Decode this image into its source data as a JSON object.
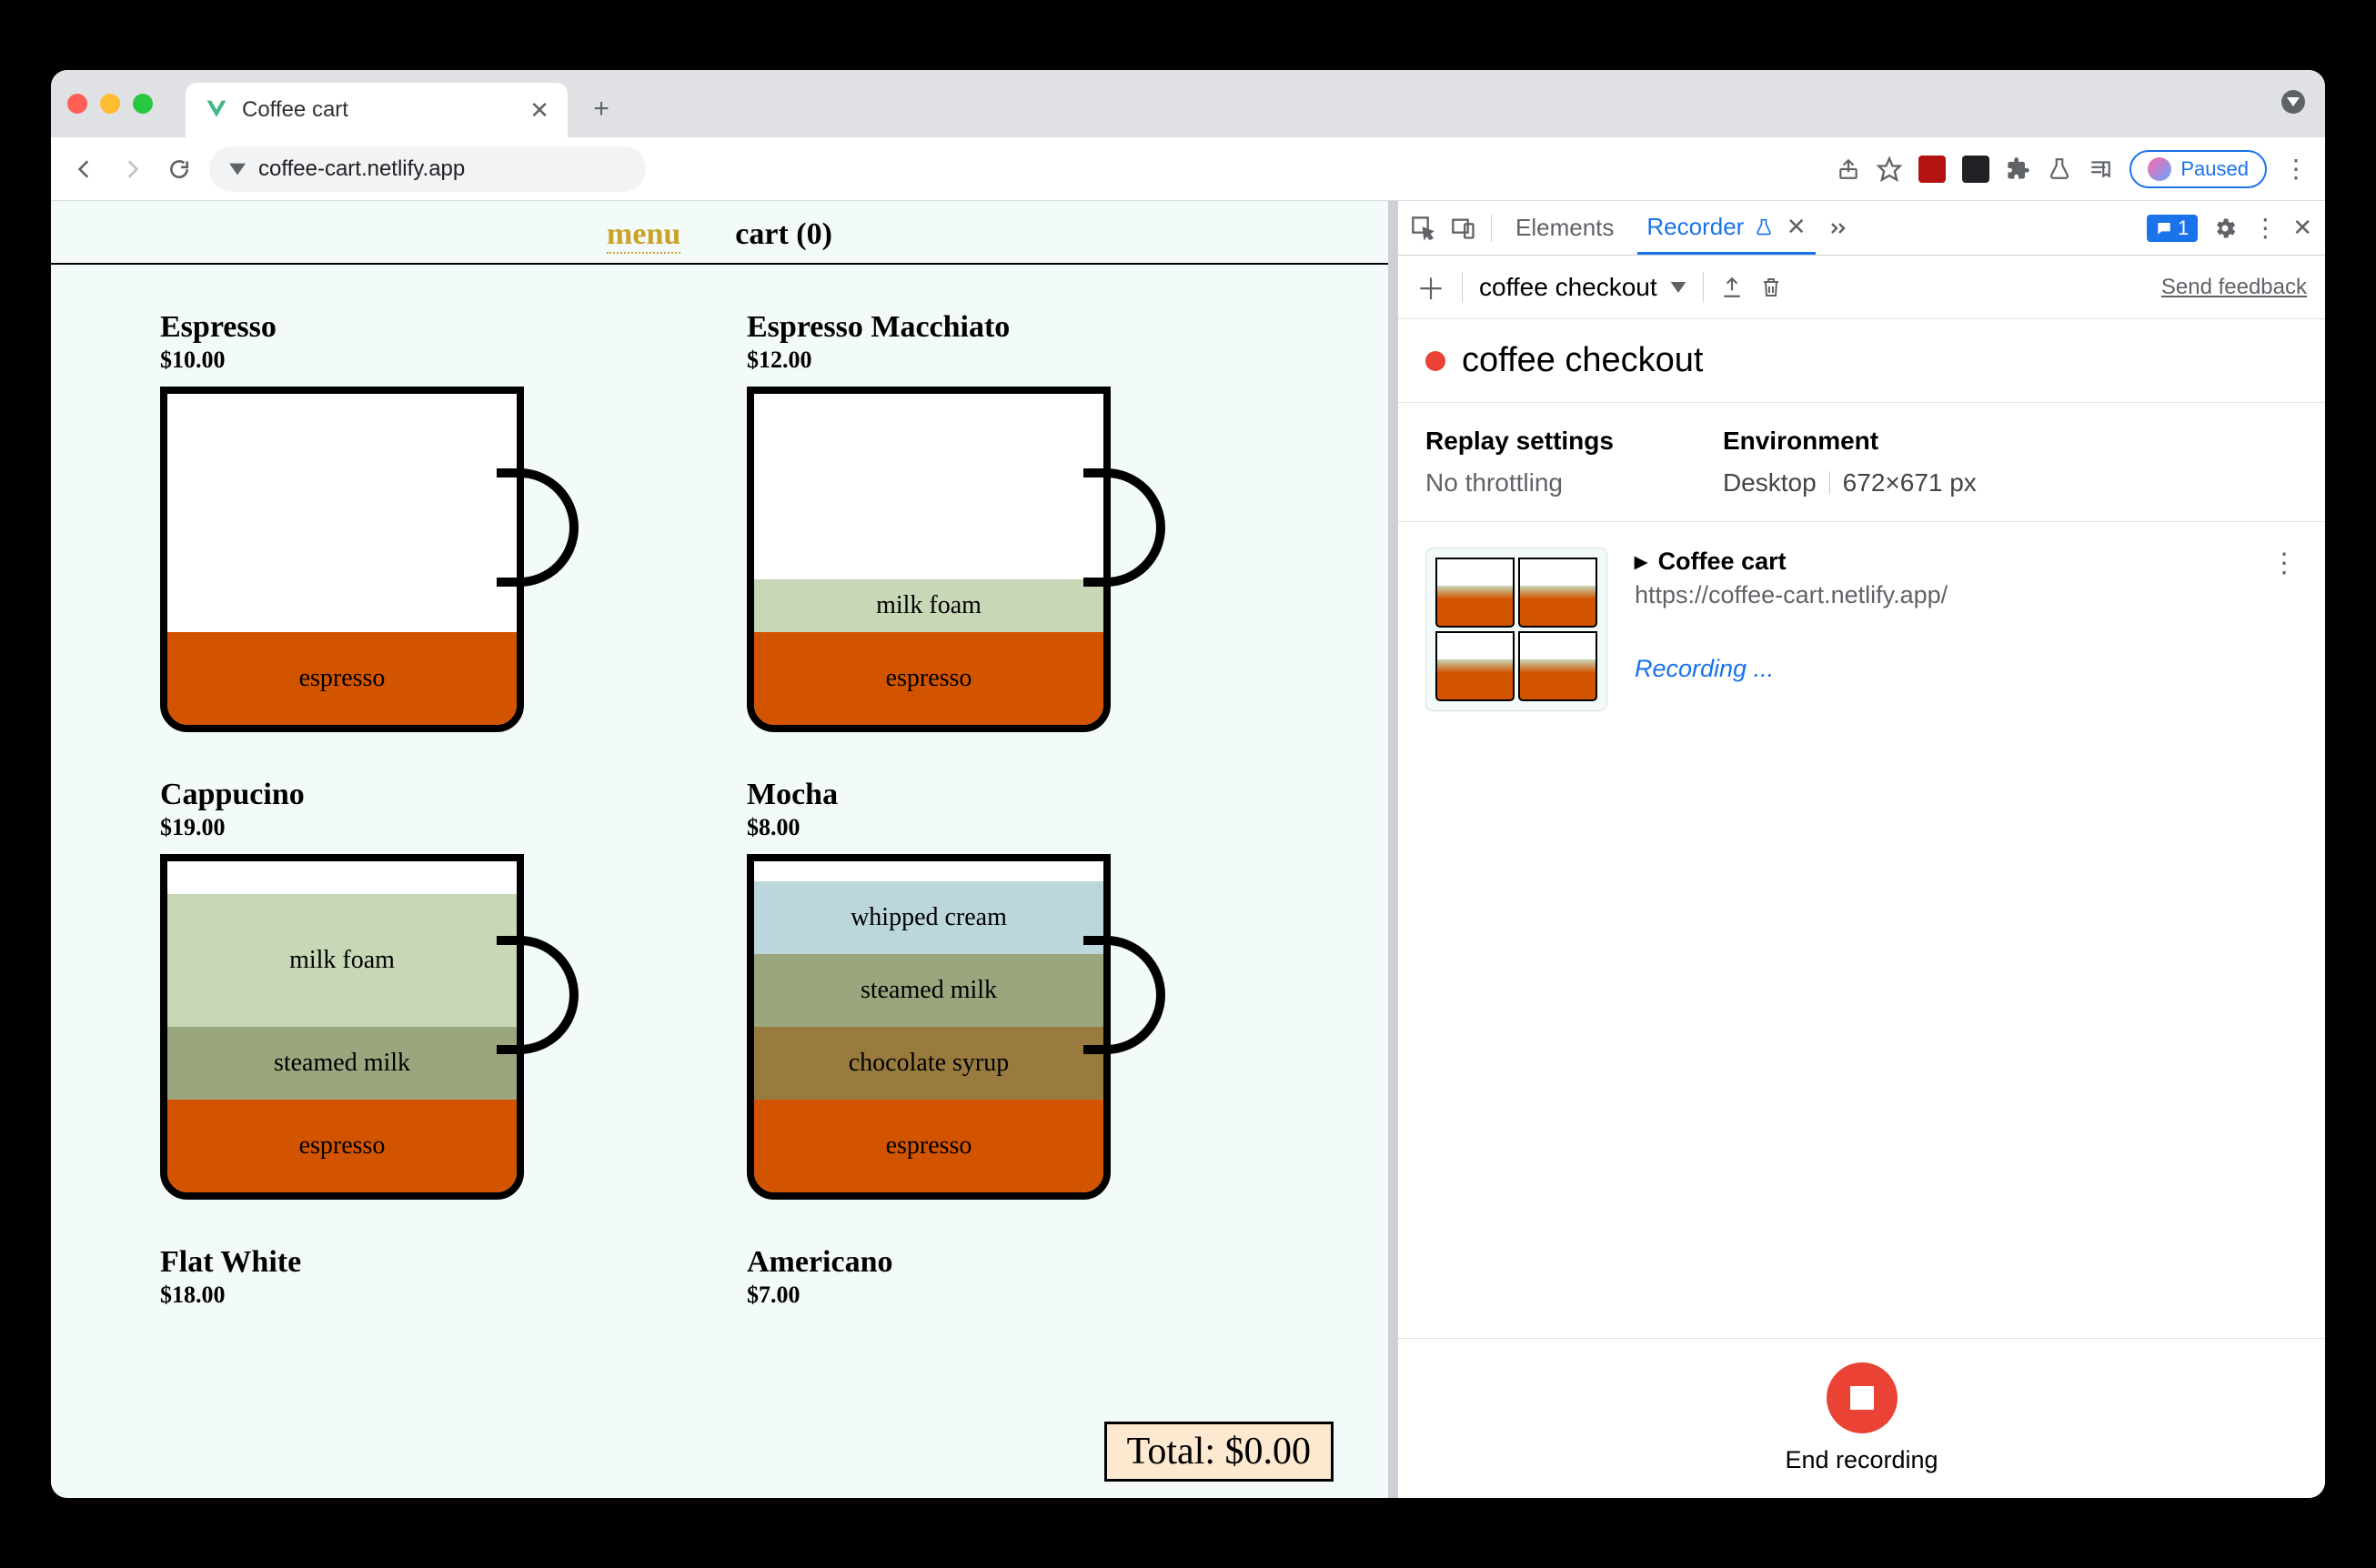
{
  "browser": {
    "tab_title": "Coffee cart",
    "url": "coffee-cart.netlify.app",
    "profile_state": "Paused",
    "message_count": "1"
  },
  "app": {
    "nav": {
      "menu": "menu",
      "cart": "cart (0)"
    },
    "items": [
      {
        "name": "Espresso",
        "price": "$10.00"
      },
      {
        "name": "Espresso Macchiato",
        "price": "$12.00"
      },
      {
        "name": "Cappucino",
        "price": "$19.00"
      },
      {
        "name": "Mocha",
        "price": "$8.00"
      },
      {
        "name": "Flat White",
        "price": "$18.00"
      },
      {
        "name": "Americano",
        "price": "$7.00"
      }
    ],
    "layers": {
      "espresso": "espresso",
      "milk_foam": "milk foam",
      "steamed_milk": "steamed milk",
      "chocolate_syrup": "chocolate syrup",
      "whipped_cream": "whipped cream"
    },
    "total": "Total: $0.00"
  },
  "devtools": {
    "tabs": {
      "elements": "Elements",
      "recorder": "Recorder"
    },
    "recorder": {
      "recording_name": "coffee checkout",
      "send_feedback": "Send feedback",
      "title": "coffee checkout",
      "settings": {
        "replay_heading": "Replay settings",
        "replay_value": "No throttling",
        "env_heading": "Environment",
        "env_device": "Desktop",
        "env_size": "672×671 px"
      },
      "step": {
        "title": "Coffee cart",
        "url": "https://coffee-cart.netlify.app/",
        "status": "Recording ..."
      },
      "footer_label": "End recording"
    }
  }
}
